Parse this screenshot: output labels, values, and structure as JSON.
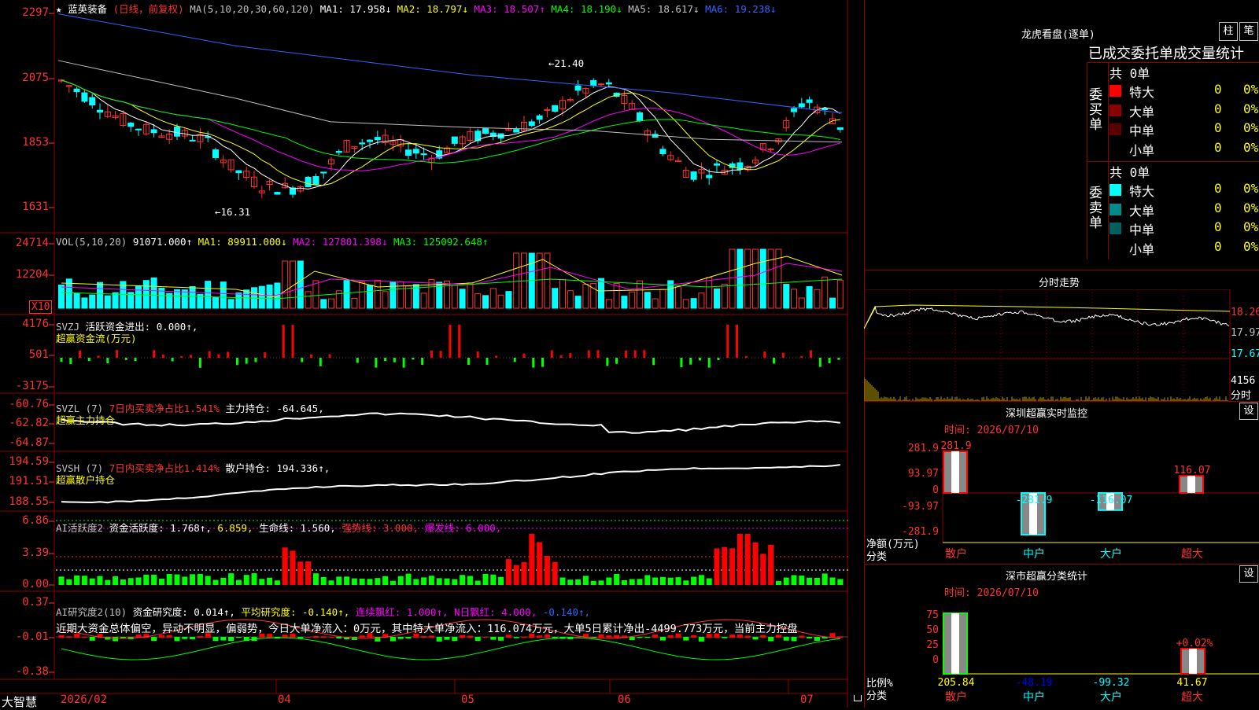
{
  "colors": {
    "up": "#ff3232",
    "down": "#00ffff",
    "ma1": "#ffffff",
    "ma2": "#ffff00",
    "ma3": "#ff00ff",
    "ma4": "#00ff00",
    "ma5": "#c0c0c0",
    "ma6": "#3264ff",
    "grid": "#8b0000"
  },
  "main": {
    "marker": "★",
    "stock": "蓝英装备",
    "period": "(日线，前复权)",
    "ma_label": "MA(5,10,20,30,60,120)",
    "ma_values": [
      {
        "name": "MA1:",
        "value": "17.958↓"
      },
      {
        "name": "MA2:",
        "value": "18.797↓"
      },
      {
        "name": "MA3:",
        "value": "18.507↑"
      },
      {
        "name": "MA4:",
        "value": "18.190↓"
      },
      {
        "name": "MA5:",
        "value": "18.617↓"
      },
      {
        "name": "MA6:",
        "value": "19.238↓"
      }
    ],
    "y_ticks": [
      "2297",
      "2075",
      "1853",
      "1631"
    ],
    "high_label": "21.40",
    "low_label": "16.31"
  },
  "vol": {
    "label": "VOL(5,10,20)",
    "value": "91071.000↑",
    "ma1": "MA1: 89911.000↓",
    "ma2": "MA2: 127801.398↓",
    "ma3": "MA3: 125092.648↑",
    "y_ticks": [
      "24714",
      "12204"
    ],
    "unit": "X10"
  },
  "svzj": {
    "label": "SVZJ",
    "desc": "活跃资金进出: 0.000↑,",
    "sub": "超赢资金流(万元)",
    "y_ticks": [
      "4176",
      "501",
      "-3175"
    ]
  },
  "svzl": {
    "label": "SVZL (7)",
    "desc_red": "7日内买卖净占比1.541%",
    "desc_white": "主力持仓: -64.645,",
    "sub": "超赢主力持仓",
    "y_ticks": [
      "-60.76",
      "-62.82",
      "-64.87"
    ]
  },
  "svsh": {
    "label": "SVSH (7)",
    "desc_red": "7日内买卖净占比1.414%",
    "desc_white": "散户持仓: 194.336↑,",
    "sub": "超赢散户持仓",
    "y_ticks": [
      "194.59",
      "191.51",
      "188.55"
    ]
  },
  "ai2": {
    "label": "AI活跃度2",
    "desc": "资金活跃度: 1.768↑,",
    "v2": "6.859,",
    "life": "生命线: 1.560,",
    "strong": "强势线: 3.000,",
    "burst": "爆发线: 6.000,",
    "y_ticks": [
      "6.86",
      "3.39",
      "0.00"
    ]
  },
  "ai_research": {
    "label": "AI研究度2(10)",
    "desc": "资金研究度: 0.014↑,",
    "avg": "平均研究度: -0.140↑,",
    "lianxu": "连续飘红: 1.000↑,",
    "nday": "N日飘红: 4.000,",
    "last": "-0.140↑,",
    "comment": "近期大资金总体偏空，异动不明显，偏弱势，今日大单净流入：0万元，其中特大单净流入：116.074万元，大单5日累计净出-4499.773万元，当前主力控盘",
    "y_ticks": [
      "0.37",
      "-0.01",
      "-0.38"
    ]
  },
  "xaxis": {
    "labels": [
      "2026/02",
      "04",
      "05",
      "06",
      "07"
    ]
  },
  "brand": "大智慧",
  "right": {
    "lhb_title": "龙虎看盘(逐单)",
    "btn_zhu": "柱",
    "btn_bi": "笔",
    "panel_title": "已成交委托单成交量统计",
    "buy": {
      "label": "委买单",
      "total": "共 0单",
      "rows": [
        {
          "name": "特大",
          "count": "0",
          "pct": "0%",
          "color": "#ff0000"
        },
        {
          "name": "大单",
          "count": "0",
          "pct": "0%",
          "color": "#8b0000"
        },
        {
          "name": "中单",
          "count": "0",
          "pct": "0%",
          "color": "#5a0000"
        },
        {
          "name": "小单",
          "count": "0",
          "pct": "0%",
          "color": ""
        }
      ]
    },
    "sell": {
      "label": "委卖单",
      "total": "共 0单",
      "rows": [
        {
          "name": "特大",
          "count": "0",
          "pct": "0%",
          "color": "#00ffff"
        },
        {
          "name": "大单",
          "count": "0",
          "pct": "0%",
          "color": "#008b8b"
        },
        {
          "name": "中单",
          "count": "0",
          "pct": "0%",
          "color": "#006060"
        },
        {
          "name": "小单",
          "count": "0",
          "pct": "0%",
          "color": ""
        }
      ]
    },
    "fenshi": {
      "title": "分时走势",
      "y": [
        "18.26",
        "17.97",
        "17.67"
      ],
      "vol": "4156",
      "vol_unit": "分时"
    },
    "sz_monitor": {
      "title": "深圳超赢实时监控",
      "btn": "设",
      "time": "时间: 2026/07/10",
      "y": [
        "281.9",
        "93.97",
        "0",
        "-93.97",
        "-281.9"
      ],
      "unit": "净额(万元)",
      "cat_label": "分类",
      "cats": [
        "散户",
        "中户",
        "大户",
        "超大"
      ],
      "values": [
        281.9,
        -281.9,
        -116.07,
        116.07
      ],
      "value_labels": [
        "281.9",
        "-281.9",
        "-116.07",
        "116.07"
      ]
    },
    "sz_class": {
      "title": "深市超赢分类统计",
      "btn": "设",
      "time": "时间: 2026/07/10",
      "y": [
        "75",
        "50",
        "25",
        "0"
      ],
      "unit": "比例%",
      "cat_label": "分类",
      "cats": [
        "散户",
        "中户",
        "大户",
        "超大"
      ],
      "values": [
        "205.84",
        "-48.19",
        "-99.32",
        "41.67"
      ],
      "top_label": "+0.02%"
    }
  }
}
